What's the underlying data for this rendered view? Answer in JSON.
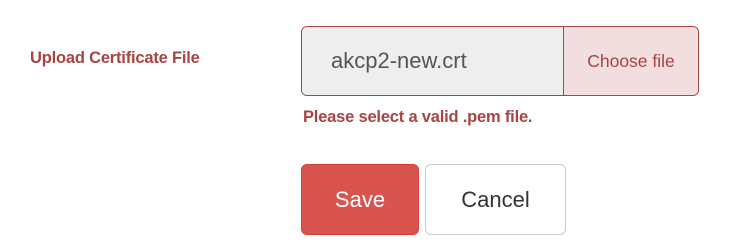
{
  "form": {
    "certificate_label": "Upload Certificate File",
    "file_name": "akcp2-new.crt",
    "choose_file_label": "Choose file",
    "error_message": "Please select a valid .pem file.",
    "save_label": "Save",
    "cancel_label": "Cancel"
  },
  "colors": {
    "label_error": "#a84442",
    "error_border": "#a94442",
    "choose_bg": "#f2dede",
    "file_bg": "#eeeeee",
    "save_bg": "#d9534f",
    "cancel_bg": "#ffffff"
  }
}
